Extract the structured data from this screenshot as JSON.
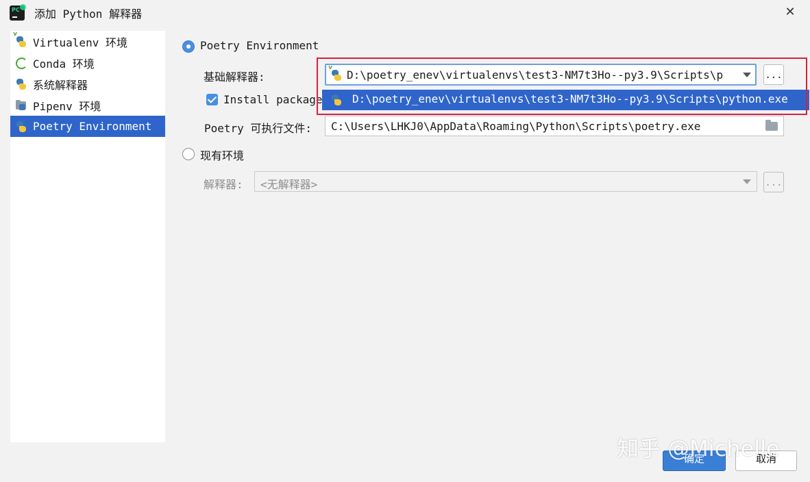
{
  "window": {
    "title": "添加 Python 解释器",
    "close_glyph": "✕",
    "app_icon_text": "PC"
  },
  "sidebar": {
    "items": [
      {
        "label": "Virtualenv 环境",
        "icon": "python-virtualenv-icon",
        "selected": false
      },
      {
        "label": "Conda 环境",
        "icon": "conda-icon",
        "selected": false
      },
      {
        "label": "系统解释器",
        "icon": "python-icon",
        "selected": false
      },
      {
        "label": "Pipenv 环境",
        "icon": "pipenv-icon",
        "selected": false
      },
      {
        "label": "Poetry Environment",
        "icon": "poetry-icon",
        "selected": true
      }
    ]
  },
  "main": {
    "poetry_radio_label": "Poetry Environment",
    "base_interpreter_label": "基础解释器:",
    "base_interpreter_value": "D:\\poetry_enev\\virtualenvs\\test3-NM7t3Ho--py3.9\\Scripts\\p",
    "dropdown_option": "D:\\poetry_enev\\virtualenvs\\test3-NM7t3Ho--py3.9\\Scripts\\python.exe",
    "browse_label": "...",
    "install_packages_label": "Install package",
    "install_packages_checked": true,
    "poetry_exe_label": "Poetry 可执行文件:",
    "poetry_exe_value": "C:\\Users\\LHKJ0\\AppData\\Roaming\\Python\\Scripts\\poetry.exe",
    "existing_env_radio_label": "现有环境",
    "interpreter_label": "解释器:",
    "interpreter_placeholder": "<无解释器>"
  },
  "footer": {
    "ok_label": "确定",
    "cancel_label": "取消"
  },
  "watermark": "知乎 @Michelle",
  "colors": {
    "selection": "#2f65ca",
    "accent": "#4a8fe0",
    "highlight_border": "#d8203c"
  }
}
